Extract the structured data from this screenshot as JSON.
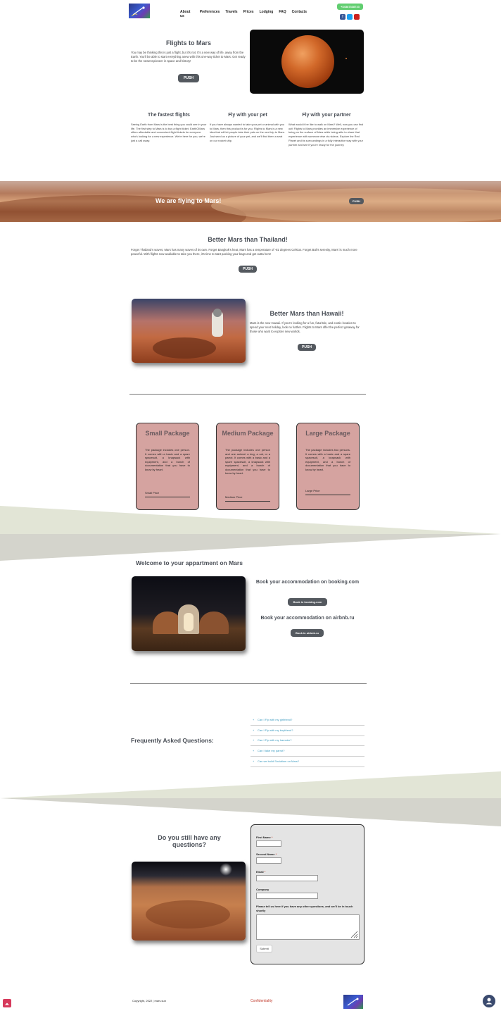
{
  "header": {
    "nav": [
      "About us",
      "Preferences",
      "Travels",
      "Prices",
      "Lodging",
      "FAQ",
      "Contacts"
    ],
    "phone": "+34387338723",
    "social": [
      "facebook-icon",
      "twitter-icon",
      "youtube-icon"
    ]
  },
  "hero": {
    "title": "Flights to Mars",
    "text": "You may be thinking this is just a flight, but it's not. It's a new way of life, away from the Earth. You'll be able to start everything anew with this one-way ticket to Mars. Get ready to be the newest pioneer in space and history!",
    "button": "PUSH"
  },
  "features": [
    {
      "title": "The fastest flights",
      "text": "Seeing Earth from Mars is the best thing you could see in your life. The first step to Mars is to buy a flight ticket. EarthOMars offers affordable and convenient flight tickets for everyone who's looking for a new experience. We're here for you, we're just a call away."
    },
    {
      "title": "Fly with your pet",
      "text": "If you have always wanted to take your pet or animal with you to Mars, then this product is for you. Flights to Mars is a new idea that will let people take their pets on the next trip to Mars. Just send us a picture of your pet, and we'll find them a seat on our rocket ship."
    },
    {
      "title": "Fly with your partner",
      "text": "What would it be like to walk on Mars? Well, now you can find out! Flights to Mars provides an immersive experience of being on the surface of Mars while being able to share that experience with someone else via videos. Explore the Red Planet and its surroundings in a fully interactive way with your partner and see if you're ready for the journey."
    }
  ],
  "banner": {
    "title": "We are flying to Mars!",
    "button": "PUSH"
  },
  "thailand": {
    "title": "Better Mars than Thailand!",
    "text": "Forget Thailand's waves, Mars has many waves of its own. Forget Bangkok's heat, Mars has a temperature of -81 degrees Celsius. Forget Bali's serenity, Mars' is much more peaceful. With flights now available to take you there, it's time to start packing your bags and get outta here!",
    "button": "PUSH"
  },
  "hawaii": {
    "title": "Better Mars than Hawaii!",
    "text": "Mars is the new Hawaii. If you're looking for a fun, futuristic, and exotic location to spend your next holiday, look no further. Flights to Mars offer the perfect getaway for those who want to explore new worlds.",
    "button": "PUSH"
  },
  "packages": [
    {
      "title": "Small Package",
      "text": "The package includes one person. It comes with a basic and a spare spacesuit, a knapsack with equipment, and a bunch of documentation that you have to know by heart.",
      "price": "Small Price"
    },
    {
      "title": "Medium Package",
      "text": "The package includes one person and one animal: a dog, a cat, or a parrot. It comes with a basic and a spare spacesuit, a knapsack with equipment, and a bunch of documentation that you have to know by heart.",
      "price": "Medium Price"
    },
    {
      "title": "Large Package",
      "text": "The package includes two persons. It comes with a basic and a spare spacesuit, a knapsack with equipment, and a bunch of documentation that you have to know by heart.",
      "price": "Large Price"
    }
  ],
  "lodging": {
    "title": "Welcome to your appartment on Mars",
    "booking_title": "Book your accommodation on booking.com",
    "booking_button": "Book in booking.com",
    "airbnb_title": "Book your accommodation on airbnb.ru",
    "airbnb_button": "Book in airbnb.ru"
  },
  "faq": {
    "title": "Frequently Asked Questions:",
    "items": [
      "Can I Fly with my girlfriend?",
      "Can I Fly with my boyfriend?",
      "Can I Fly with my hamster?",
      "Can I take my parrot?",
      "Can we build Socialism on Mars?"
    ]
  },
  "contact": {
    "title": "Do you still have any questions?",
    "first_name": "First Name",
    "second_name": "Second Name",
    "email": "Email",
    "company": "Company",
    "message": "Please tell us here if you have any other questions, and we'll be in touch shortly",
    "submit": "Submit",
    "required_mark": "*"
  },
  "footer": {
    "copyright": "Copyright, 2022 | mars.sun",
    "confidentiality": "Confidentiality"
  },
  "colors": {
    "button": "#54595f",
    "package_bg": "#d5a3a0",
    "phone_bg": "#61ce70",
    "faq_link": "#3a9abf",
    "footer_link": "#c0392b",
    "scroll_top": "#d63a5c"
  }
}
